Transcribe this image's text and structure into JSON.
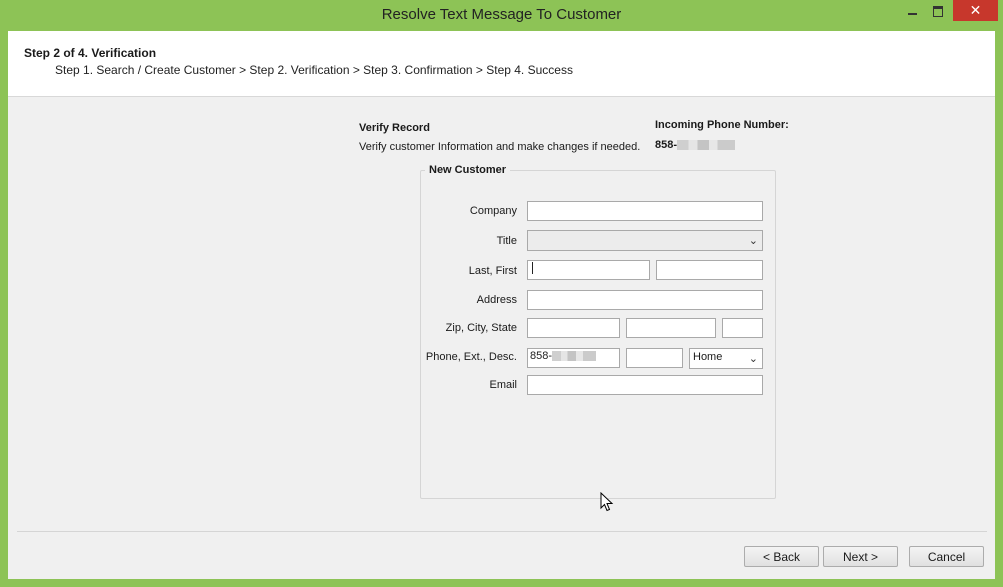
{
  "window": {
    "title": "Resolve Text Message To Customer",
    "close_glyph": "✕"
  },
  "header": {
    "step_title": "Step 2 of 4. Verification",
    "step_trail": "Step 1. Search / Create Customer > Step 2. Verification > Step 3. Confirmation > Step 4. Success"
  },
  "verify": {
    "title": "Verify Record",
    "description": "Verify customer Information and make changes if needed."
  },
  "incoming": {
    "label": "Incoming Phone Number:",
    "number_prefix": "858-"
  },
  "group": {
    "legend": "New Customer"
  },
  "form": {
    "company_label": "Company",
    "title_label": "Title",
    "title_value": "",
    "last_first_label": "Last, First",
    "address_label": "Address",
    "zip_city_state_label": "Zip, City, State",
    "phone_label": "Phone, Ext., Desc.",
    "phone_prefix": "858-",
    "phone_desc_value": "Home",
    "email_label": "Email",
    "chevron": "⌄"
  },
  "footer": {
    "back_label": "< Back",
    "next_label": "Next >",
    "cancel_label": "Cancel"
  },
  "colors": {
    "frame": "#8dc356",
    "close_button": "#c7372c"
  }
}
